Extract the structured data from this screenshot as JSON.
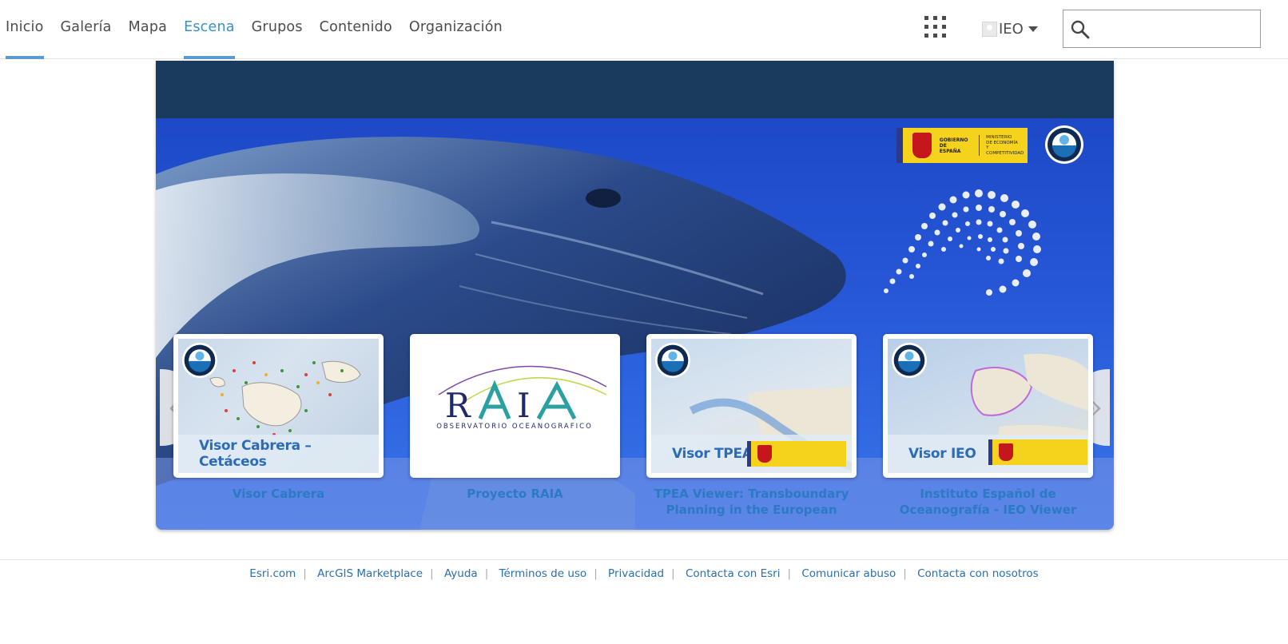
{
  "nav": {
    "links": [
      "Inicio",
      "Galería",
      "Mapa",
      "Escena",
      "Grupos",
      "Contenido",
      "Organización"
    ],
    "active_index": 3,
    "user_name": "IEO",
    "search_placeholder": ""
  },
  "hero": {
    "gov_logo_text": [
      "GOBIERNO",
      "DE ESPAÑA"
    ],
    "gov_ministry_text": [
      "MINISTERIO",
      "DE ECONOMÍA",
      "Y COMPETITIVIDAD"
    ]
  },
  "carousel": {
    "items": [
      {
        "title": "Visor Cabrera",
        "thumb_caption": "Visor Cabrera – Cetáceos"
      },
      {
        "title": "Proyecto RAIA",
        "thumb_caption": "",
        "logo_text": "RAIA",
        "logo_subtext": "OBSERVATORIO OCEANOGRAFICO"
      },
      {
        "title": "TPEA Viewer: Transboundary Planning in the European",
        "thumb_caption": "Visor TPEA"
      },
      {
        "title": "Instituto Español de Oceanografía - IEO Viewer",
        "thumb_caption": "Visor IEO"
      }
    ],
    "prev_label": "«",
    "next_label": "»"
  },
  "footer": {
    "links": [
      "Esri.com",
      "ArcGIS Marketplace",
      "Ayuda",
      "Términos de uso",
      "Privacidad",
      "Contacta con Esri",
      "Comunicar abuso",
      "Contacta con nosotros"
    ]
  },
  "colors": {
    "accent": "#5b9bd1",
    "active_link": "#3a8fc7",
    "banner": "#1b3b5e",
    "card_title": "#2a7ac4"
  }
}
